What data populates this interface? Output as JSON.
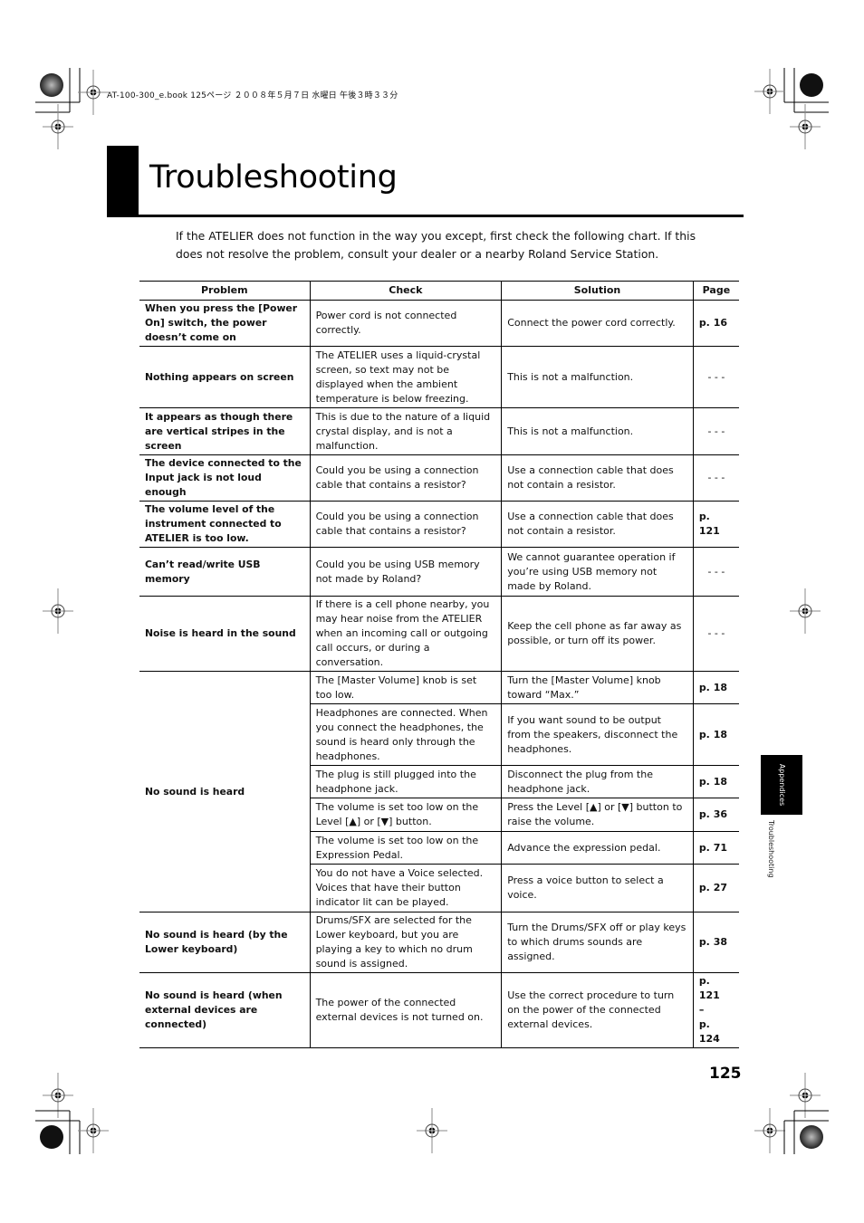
{
  "print_header": "AT-100-300_e.book  125ページ  ２００８年５月７日  水曜日  午後３時３３分",
  "page_title": "Troubleshooting",
  "intro_text": "If the ATELIER does not function in the way you except, first check the following chart. If this does not resolve the problem, consult your dealer or a nearby Roland Service Station.",
  "table": {
    "headers": [
      "Problem",
      "Check",
      "Solution",
      "Page"
    ],
    "rows": [
      {
        "problem": "When you press the [Power On] switch, the power doesn’t come on",
        "check": "Power cord is not connected correctly.",
        "solution": "Connect the power cord correctly.",
        "page": "p. 16"
      },
      {
        "problem": "Nothing appears on screen",
        "check": "The ATELIER uses a liquid-crystal screen, so text may not be displayed when the ambient temperature is below freezing.",
        "solution": "This is not a malfunction.",
        "page": "- - -"
      },
      {
        "problem": "It appears as though there are vertical stripes in the screen",
        "check": "This is due to the nature of a liquid crystal display, and is not a malfunction.",
        "solution": "This is not a malfunction.",
        "page": "- - -"
      },
      {
        "problem": "The device connected to the Input jack is not loud enough",
        "check": "Could you be using a connection cable that contains a resistor?",
        "solution": "Use a connection cable that does not contain a resistor.",
        "page": "- - -"
      },
      {
        "problem": "The volume level of the instrument connected to ATELIER is too low.",
        "check": "Could you be using a connection cable that contains a resistor?",
        "solution": "Use a connection cable that does not contain a resistor.",
        "page": "p. 121"
      },
      {
        "problem": "Can’t read/write USB memory",
        "check": "Could you be using USB memory not made by Roland?",
        "solution": "We cannot guarantee operation if you’re using USB memory not made by Roland.",
        "page": "- - -"
      },
      {
        "problem": "Noise is heard in the sound",
        "check": "If there is a cell phone nearby, you may hear noise from the ATELIER when an incoming call or outgoing call occurs, or during a conversation.",
        "solution": "Keep the cell phone as far away as possible, or turn off its power.",
        "page": "- - -"
      }
    ],
    "no_sound": {
      "problem": "No sound is heard",
      "items": [
        {
          "check": "The [Master Volume] knob is set too low.",
          "solution": "Turn the [Master Volume] knob toward “Max.”",
          "page": "p. 18"
        },
        {
          "check": "Headphones are connected. When you connect the headphones, the sound is heard only through the headphones.",
          "solution": "If you want sound to be output from the speakers, disconnect the headphones.",
          "page": "p. 18"
        },
        {
          "check": "The plug is still plugged into the headphone jack.",
          "solution": "Disconnect the plug from the headphone jack.",
          "page": "p. 18"
        },
        {
          "check": "The volume is set too low on the Level [▲] or [▼] button.",
          "solution": "Press the Level [▲] or [▼] button to raise the volume.",
          "page": "p. 36"
        },
        {
          "check": "The volume is set too low on the Expression Pedal.",
          "solution": "Advance the expression pedal.",
          "page": "p. 71"
        },
        {
          "check": "You do not have a Voice selected. Voices that have their button indicator lit can be played.",
          "solution": "Press a voice button to select a voice.",
          "page": "p. 27"
        }
      ]
    },
    "tail_rows": [
      {
        "problem": "No sound is heard (by the Lower keyboard)",
        "check": "Drums/SFX are selected for the Lower keyboard, but you are playing a key to which no drum sound is assigned.",
        "solution": "Turn the Drums/SFX off or play keys to which drums sounds are assigned.",
        "page": "p. 38"
      },
      {
        "problem": "No sound is heard (when external devices are connected)",
        "check": "The power of the connected external devices is not turned on.",
        "solution": "Use the correct procedure to turn on the power of the connected external devices.",
        "page_lines": [
          "p. 121",
          "–",
          "p. 124"
        ]
      }
    ]
  },
  "side_tab": {
    "label": "Appendices",
    "section": "Troubleshooting"
  },
  "page_number": "125",
  "icons": {
    "registration_mark": "crosshair-target-icon",
    "color_bar": "radial-target-icon"
  }
}
